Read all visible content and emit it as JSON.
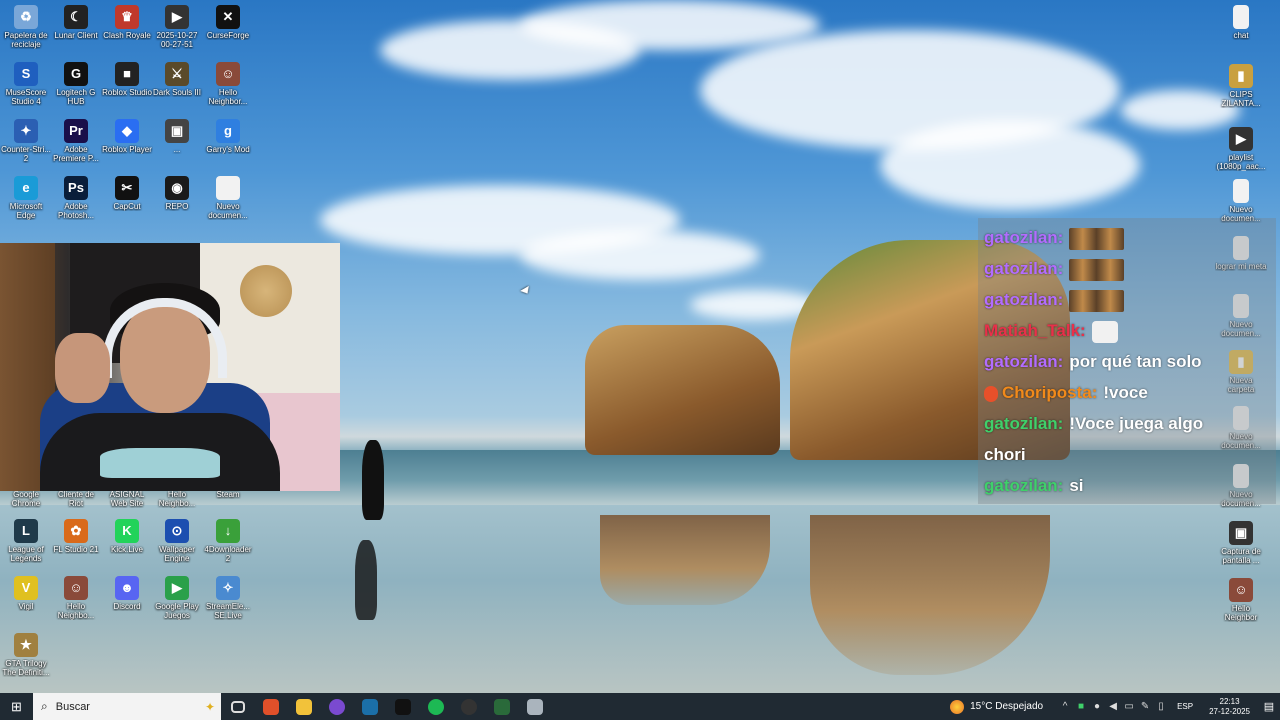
{
  "desktop_icons_left": [
    {
      "label": "Papelera de reciclaje",
      "icon": "recycle-bin-icon",
      "color": "#7aa7d8",
      "glyph": "♻"
    },
    {
      "label": "Lunar Client",
      "icon": "lunar-client-icon",
      "color": "#222222",
      "glyph": "☾"
    },
    {
      "label": "Clash Royale",
      "icon": "clash-royale-icon",
      "color": "#c0392b",
      "glyph": "♛"
    },
    {
      "label": "2025-10-27 00-27-51",
      "icon": "video-file-icon",
      "color": "#333333",
      "glyph": "▶"
    },
    {
      "label": "CurseForge",
      "icon": "curseforge-icon",
      "color": "#111111",
      "glyph": "✕"
    },
    {
      "label": "MuseScore Studio 4",
      "icon": "musescore-icon",
      "color": "#1f5fbf",
      "glyph": "S"
    },
    {
      "label": "Logitech G HUB",
      "icon": "logitech-icon",
      "color": "#111111",
      "glyph": "G"
    },
    {
      "label": "Roblox Studio",
      "icon": "roblox-studio-icon",
      "color": "#222222",
      "glyph": "■"
    },
    {
      "label": "Dark Souls III",
      "icon": "dark-souls-icon",
      "color": "#5a4a2a",
      "glyph": "⚔"
    },
    {
      "label": "Hello Neighbor...",
      "icon": "hello-neighbor-icon",
      "color": "#8a4a3a",
      "glyph": "☺"
    },
    {
      "label": "Counter-Stri... 2",
      "icon": "counter-strike-icon",
      "color": "#2b5fb3",
      "glyph": "✦"
    },
    {
      "label": "Adobe Premiere P...",
      "icon": "premiere-icon",
      "color": "#1a0f4a",
      "glyph": "Pr"
    },
    {
      "label": "Roblox Player",
      "icon": "roblox-player-icon",
      "color": "#2a6ef2",
      "glyph": "◆"
    },
    {
      "label": "...",
      "icon": "image-file-icon",
      "color": "#444444",
      "glyph": "▣"
    },
    {
      "label": "Garry's Mod",
      "icon": "garrys-mod-icon",
      "color": "#2f7fe0",
      "glyph": "g"
    },
    {
      "label": "Microsoft Edge",
      "icon": "edge-icon",
      "color": "#1a9bd7",
      "glyph": "e"
    },
    {
      "label": "Adobe Photosh...",
      "icon": "photoshop-icon",
      "color": "#0a1e3a",
      "glyph": "Ps"
    },
    {
      "label": "CapCut",
      "icon": "capcut-icon",
      "color": "#111111",
      "glyph": "✂"
    },
    {
      "label": "REPO",
      "icon": "repo-icon",
      "color": "#1a1a1a",
      "glyph": "◉"
    },
    {
      "label": "Nuevo documen...",
      "icon": "text-document-icon",
      "color": "#f2f2f2",
      "glyph": ""
    },
    {
      "label": "Google Chrome",
      "icon": "chrome-icon",
      "color": "#3b8a3a",
      "glyph": "◎"
    },
    {
      "label": "Cliente de Riot",
      "icon": "riot-client-icon",
      "color": "#d13a2a",
      "glyph": "R"
    },
    {
      "label": "ASIGNAL Web Site",
      "icon": "web-site-icon",
      "color": "#4a4a4a",
      "glyph": "⌂"
    },
    {
      "label": "Hello Neighbo...",
      "icon": "hello-neighbor-icon",
      "color": "#8a4a3a",
      "glyph": "☺"
    },
    {
      "label": "Steam",
      "icon": "steam-icon",
      "color": "#1b2838",
      "glyph": "⚙"
    },
    {
      "label": "League of Legends",
      "icon": "league-icon",
      "color": "#1f3a4a",
      "glyph": "L"
    },
    {
      "label": "FL Studio 21",
      "icon": "fl-studio-icon",
      "color": "#d96a1a",
      "glyph": "✿"
    },
    {
      "label": "Kick.Live",
      "icon": "kick-icon",
      "color": "#22d35a",
      "glyph": "K"
    },
    {
      "label": "Wallpaper Engine",
      "icon": "wallpaper-engine-icon",
      "color": "#1c4fb0",
      "glyph": "⊙"
    },
    {
      "label": "4Downloader 2",
      "icon": "downloader-icon",
      "color": "#3aa03a",
      "glyph": "↓"
    },
    {
      "label": "Vigil",
      "icon": "vigil-icon",
      "color": "#e0c020",
      "glyph": "V"
    },
    {
      "label": "Hello Neighbo...",
      "icon": "hello-neighbor-icon",
      "color": "#8a4a3a",
      "glyph": "☺"
    },
    {
      "label": "Discord",
      "icon": "discord-icon",
      "color": "#5865f2",
      "glyph": "☻"
    },
    {
      "label": "Google Play Juegos",
      "icon": "google-play-games-icon",
      "color": "#2aa04a",
      "glyph": "▶"
    },
    {
      "label": "StreamEle... SE.Live",
      "icon": "streamelements-icon",
      "color": "#4a8ad0",
      "glyph": "✧"
    },
    {
      "label": "GTA Trilogy The Definiti...",
      "icon": "gta-icon",
      "color": "#a08040",
      "glyph": "★"
    }
  ],
  "desktop_icons_right": [
    {
      "label": "chat",
      "icon": "text-document-icon",
      "color": "#f2f2f2",
      "glyph": ""
    },
    {
      "label": "CLIPS ZILANTA...",
      "icon": "folder-icon",
      "color": "#c9a040",
      "glyph": "▮"
    },
    {
      "label": "playlist (1080p_aac...",
      "icon": "video-file-icon",
      "color": "#333333",
      "glyph": "▶"
    },
    {
      "label": "Nuevo documen...",
      "icon": "text-document-icon",
      "color": "#f2f2f2",
      "glyph": ""
    },
    {
      "label": "lograr mi meta",
      "icon": "text-document-icon",
      "color": "#f2f2f2",
      "glyph": ""
    },
    {
      "label": "Nuevo documen...",
      "icon": "text-document-icon",
      "color": "#f2f2f2",
      "glyph": ""
    },
    {
      "label": "Nueva carpeta",
      "icon": "folder-icon",
      "color": "#e8c050",
      "glyph": "▮"
    },
    {
      "label": "Nuevo documen...",
      "icon": "text-document-icon",
      "color": "#f2f2f2",
      "glyph": ""
    },
    {
      "label": "Nuevo documen...",
      "icon": "text-document-icon",
      "color": "#f2f2f2",
      "glyph": ""
    },
    {
      "label": "Captura de pantalla ...",
      "icon": "screenshot-file-icon",
      "color": "#333333",
      "glyph": "▣"
    },
    {
      "label": "Hello Neighbor",
      "icon": "hello-neighbor-icon",
      "color": "#8a4a3a",
      "glyph": "☺"
    }
  ],
  "chat": {
    "messages": [
      {
        "user": "gatozilan:",
        "user_color": "#b36cff",
        "text": "",
        "emote": "lol-emote"
      },
      {
        "user": "gatozilan:",
        "user_color": "#b36cff",
        "text": "",
        "emote": "lol-emote"
      },
      {
        "user": "gatozilan:",
        "user_color": "#b36cff",
        "text": "",
        "emote": "lol-emote"
      },
      {
        "user": "Matiah_Talk:",
        "user_color": "#e8304a",
        "text": "",
        "emote": "cat-emote"
      },
      {
        "user": "gatozilan:",
        "user_color": "#b36cff",
        "text": "por qué tan solo",
        "emote": ""
      },
      {
        "user": "Choriposta:",
        "user_color": "#f28a1a",
        "text": "!voce",
        "emote": "",
        "badge": "mic-badge"
      },
      {
        "user": "gatozilan:",
        "user_color": "#3fd06a",
        "text": "!Voce juega algo",
        "emote": ""
      },
      {
        "user": "",
        "user_color": "#ffffff",
        "text": "chori",
        "emote": ""
      },
      {
        "user": "gatozilan:",
        "user_color": "#3fd06a",
        "text": "si",
        "emote": ""
      }
    ]
  },
  "taskbar": {
    "start_icon": "windows-start-icon",
    "search_placeholder": "Buscar",
    "apps": [
      {
        "icon": "task-view-icon",
        "color": "#202a33"
      },
      {
        "icon": "brave-icon",
        "color": "#e0502a"
      },
      {
        "icon": "file-explorer-icon",
        "color": "#f2c23a"
      },
      {
        "icon": "browser-icon",
        "color": "#7a4ad0"
      },
      {
        "icon": "steam-icon",
        "color": "#1b6fa8"
      },
      {
        "icon": "capcut-icon",
        "color": "#111111"
      },
      {
        "icon": "spotify-icon",
        "color": "#1db954"
      },
      {
        "icon": "obs-icon",
        "color": "#333333"
      },
      {
        "icon": "battery-app-icon",
        "color": "#2a6a3a"
      },
      {
        "icon": "folder-window-icon",
        "color": "#aab4bd"
      }
    ],
    "weather": {
      "temp": "15°C",
      "condition": "Despejado"
    },
    "language": "ESP",
    "time": "22:13",
    "date": "27-12-2025"
  }
}
